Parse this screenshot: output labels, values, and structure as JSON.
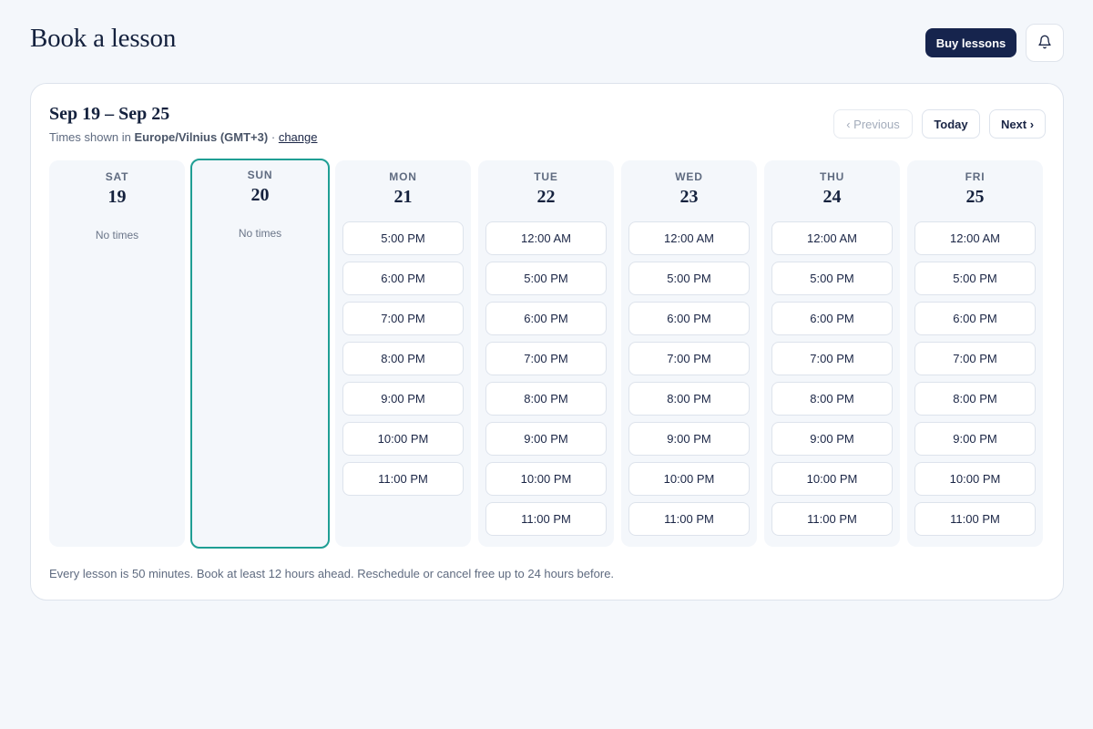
{
  "header": {
    "title": "Book a lesson",
    "buy_label": "Buy lessons",
    "bell_icon": "bell-icon"
  },
  "calendar": {
    "range": "Sep 19 – Sep 25",
    "tz_prefix": "Times shown in",
    "timezone": "Europe/Vilnius (GMT+3)",
    "tz_sep": "·",
    "change_label": "change",
    "nav": {
      "previous": "‹ Previous",
      "today": "Today",
      "next": "Next ›"
    },
    "days": [
      {
        "name": "SAT",
        "date": "19",
        "selected": false,
        "empty_text": "No times",
        "slots": []
      },
      {
        "name": "SUN",
        "date": "20",
        "selected": true,
        "empty_text": "No times",
        "slots": []
      },
      {
        "name": "MON",
        "date": "21",
        "selected": false,
        "slots": [
          "5:00 PM",
          "6:00 PM",
          "7:00 PM",
          "8:00 PM",
          "9:00 PM",
          "10:00 PM",
          "11:00 PM"
        ]
      },
      {
        "name": "TUE",
        "date": "22",
        "selected": false,
        "slots": [
          "12:00 AM",
          "5:00 PM",
          "6:00 PM",
          "7:00 PM",
          "8:00 PM",
          "9:00 PM",
          "10:00 PM",
          "11:00 PM"
        ]
      },
      {
        "name": "WED",
        "date": "23",
        "selected": false,
        "slots": [
          "12:00 AM",
          "5:00 PM",
          "6:00 PM",
          "7:00 PM",
          "8:00 PM",
          "9:00 PM",
          "10:00 PM",
          "11:00 PM"
        ]
      },
      {
        "name": "THU",
        "date": "24",
        "selected": false,
        "slots": [
          "12:00 AM",
          "5:00 PM",
          "6:00 PM",
          "7:00 PM",
          "8:00 PM",
          "9:00 PM",
          "10:00 PM",
          "11:00 PM"
        ]
      },
      {
        "name": "FRI",
        "date": "25",
        "selected": false,
        "slots": [
          "12:00 AM",
          "5:00 PM",
          "6:00 PM",
          "7:00 PM",
          "8:00 PM",
          "9:00 PM",
          "10:00 PM",
          "11:00 PM"
        ]
      }
    ],
    "footer": "Every lesson is 50 minutes. Book at least 12 hours ahead. Reschedule or cancel free up to 24 hours before."
  },
  "colors": {
    "background": "#f4f7fb",
    "primary": "#16244d",
    "selected_border": "#1f9e94"
  }
}
